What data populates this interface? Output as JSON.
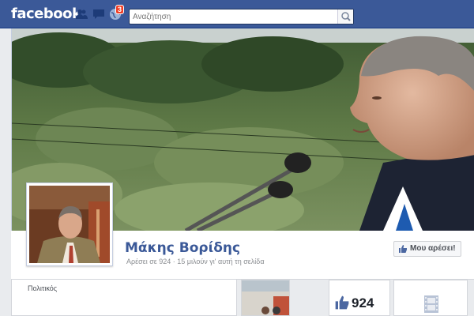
{
  "topbar": {
    "logo": "facebook",
    "notification_count": "3",
    "search_placeholder": "Αναζήτηση"
  },
  "page": {
    "name": "Μάκης Βορίδης",
    "likes_line": "Αρέσει σε 924 · 15 μιλούν γι' αυτή τη σελίδα",
    "like_button": "Μου αρέσει!",
    "category": "Πολιτικός"
  },
  "tabs": {
    "likes_count": "924"
  },
  "icons": {
    "friends": "friends-icon",
    "messages": "messages-icon",
    "notifications": "globe-icon",
    "search": "search-icon",
    "like": "thumbs-up-icon",
    "videos": "film-icon"
  },
  "colors": {
    "brand": "#3b5998",
    "badge": "#f03d25"
  }
}
